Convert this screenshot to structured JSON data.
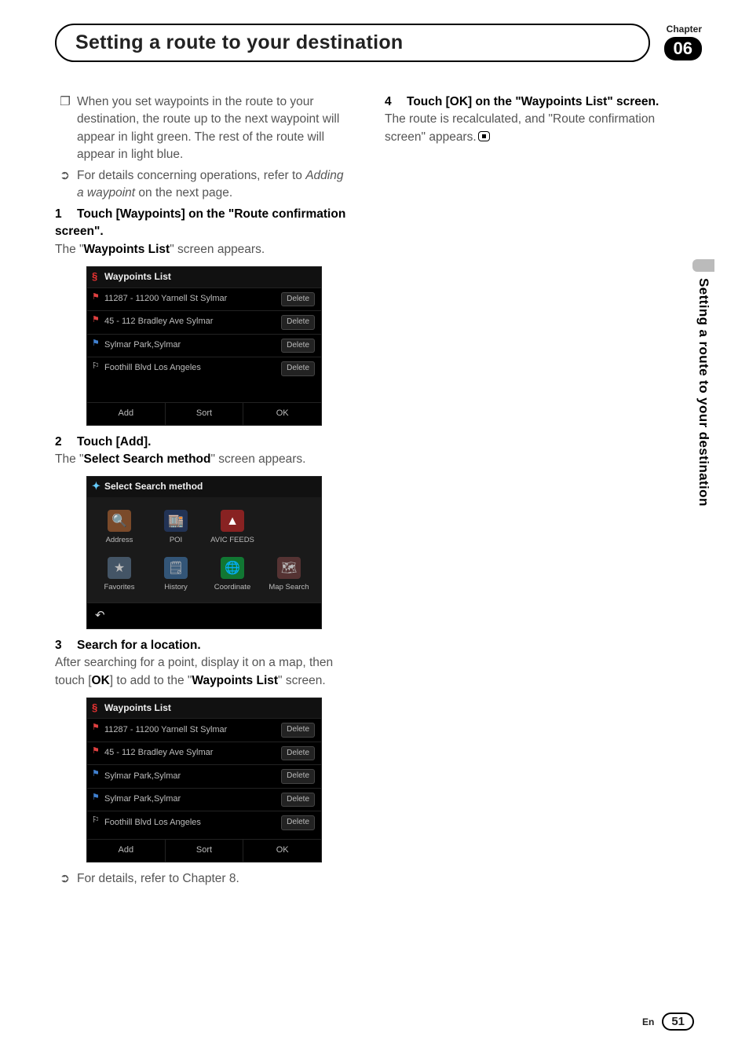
{
  "chapter": {
    "label": "Chapter",
    "number": "06"
  },
  "page_title": "Setting a route to your destination",
  "side_tab": "Setting a route to your destination",
  "left": {
    "note_bullet": "When you set waypoints in the route to your destination, the route up to the next waypoint will appear in light green. The rest of the route will appear in light blue.",
    "ref_bullet_prefix": "For details concerning operations, refer to ",
    "ref_bullet_italic": "Adding a waypoint",
    "ref_bullet_suffix": " on the next page.",
    "step1_head_num": "1",
    "step1_head": "Touch [Waypoints] on the \"Route confirmation screen\".",
    "step1_body_pre": "The \"",
    "step1_body_bold": "Waypoints List",
    "step1_body_post": "\" screen appears.",
    "step2_head_num": "2",
    "step2_head": "Touch [Add].",
    "step2_body_pre": "The \"",
    "step2_body_bold": "Select Search method",
    "step2_body_post": "\" screen appears.",
    "step3_head_num": "3",
    "step3_head": "Search for a location.",
    "step3_body_pre": "After searching for a point, display it on a map, then touch [",
    "step3_body_bold1": "OK",
    "step3_body_mid": "] to add to the \"",
    "step3_body_bold2": "Waypoints List",
    "step3_body_post": "\" screen.",
    "ref2": "For details, refer to Chapter 8."
  },
  "right": {
    "step4_head_num": "4",
    "step4_head": "Touch [OK] on the \"Waypoints List\" screen.",
    "step4_body": "The route is recalculated, and \"Route confirmation screen\" appears."
  },
  "ss_waypoints": {
    "title": "Waypoints List",
    "rows": [
      {
        "label": "11287 - 11200 Yarnell St Sylmar",
        "flag": "red"
      },
      {
        "label": "45 - 112 Bradley Ave Sylmar",
        "flag": "red"
      },
      {
        "label": "Sylmar Park,Sylmar",
        "flag": "blue"
      },
      {
        "label": "Foothill Blvd Los Angeles",
        "flag": "white"
      }
    ],
    "delete": "Delete",
    "footer": [
      "Add",
      "Sort",
      "OK"
    ]
  },
  "ss_waypoints2": {
    "title": "Waypoints List",
    "rows": [
      {
        "label": "11287 - 11200 Yarnell St Sylmar",
        "flag": "red"
      },
      {
        "label": "45 - 112 Bradley Ave Sylmar",
        "flag": "red"
      },
      {
        "label": "Sylmar Park,Sylmar",
        "flag": "blue"
      },
      {
        "label": "Sylmar Park,Sylmar",
        "flag": "blue"
      },
      {
        "label": "Foothill Blvd Los Angeles",
        "flag": "white"
      }
    ],
    "delete": "Delete",
    "footer": [
      "Add",
      "Sort",
      "OK"
    ]
  },
  "ss_search": {
    "title": "Select Search method",
    "tiles": [
      "Address",
      "POI",
      "AVIC FEEDS",
      "",
      "Favorites",
      "History",
      "Coordinate",
      "Map Search"
    ],
    "back": "↶"
  },
  "footer": {
    "lang": "En",
    "page": "51"
  }
}
